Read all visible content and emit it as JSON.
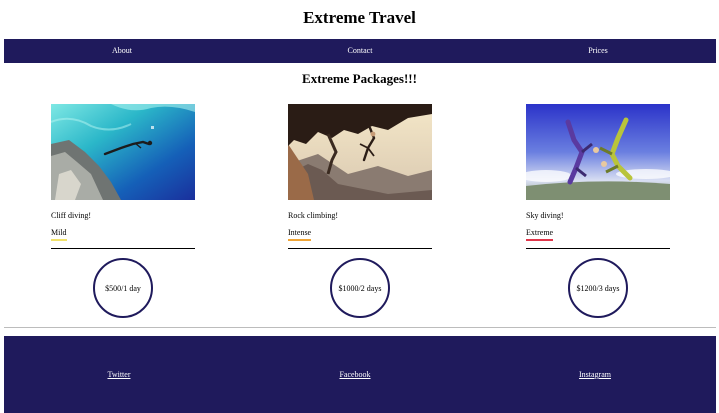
{
  "header": {
    "title": "Extreme Travel"
  },
  "nav": {
    "items": [
      "About",
      "Contact",
      "Prices"
    ]
  },
  "main": {
    "title": "Extreme Packages!!!",
    "packages": [
      {
        "name": "Cliff diving!",
        "intensity": "Mild",
        "intensity_color": "#f1e26a",
        "price": "$500/1 day"
      },
      {
        "name": "Rock climbing!",
        "intensity": "Intense",
        "intensity_color": "#f0a536",
        "price": "$1000/2 days"
      },
      {
        "name": "Sky diving!",
        "intensity": "Extreme",
        "intensity_color": "#e0364a",
        "price": "$1200/3 days"
      }
    ]
  },
  "footer": {
    "links": [
      "Twitter",
      "Facebook",
      "Instagram"
    ]
  },
  "colors": {
    "navbar": "#1f1a5c",
    "footer": "#1f1a5c",
    "text": "#000000"
  }
}
